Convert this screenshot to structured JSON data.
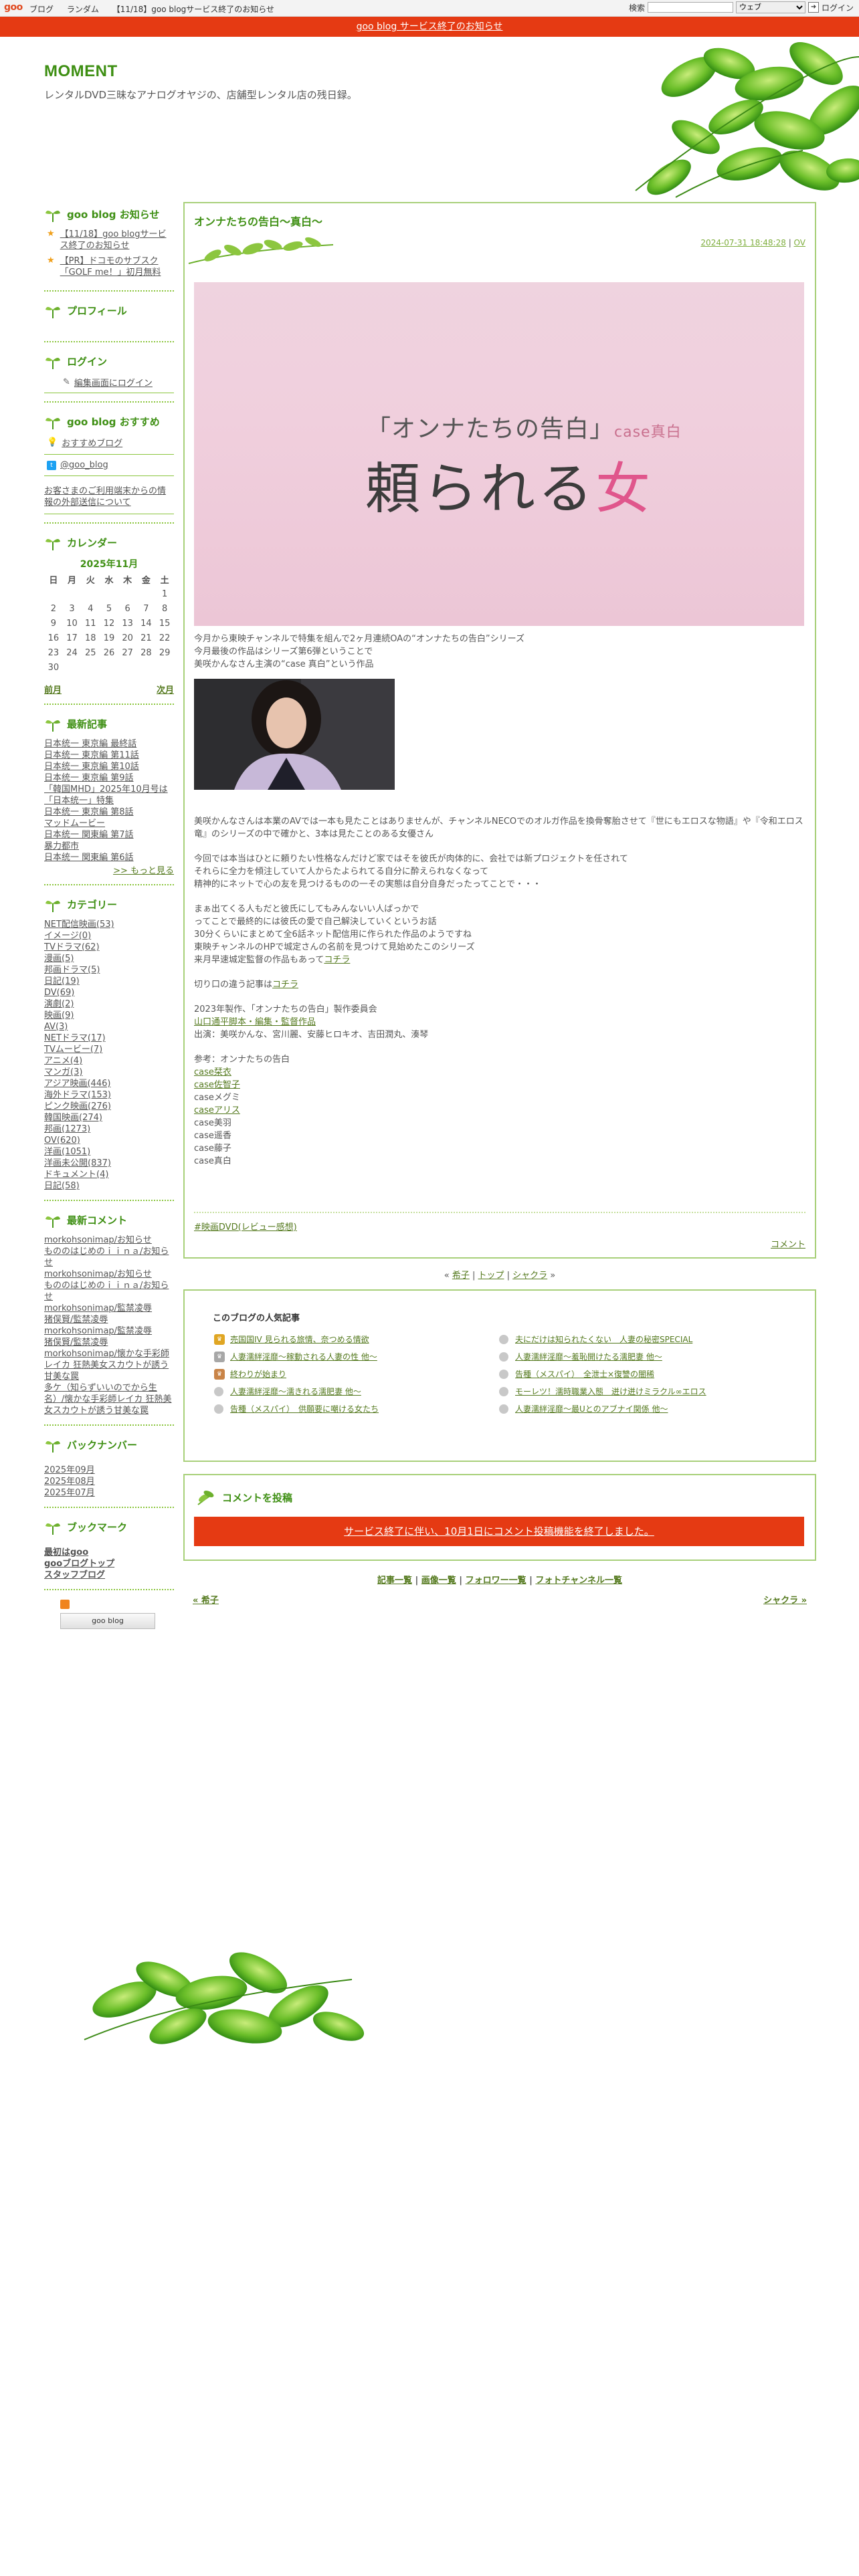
{
  "topbar": {
    "logo": "goo",
    "links": [
      "ブログ",
      "ランダム",
      "【11/18】goo blogサービス終了のお知らせ"
    ],
    "search_label": "検索",
    "search_scope": "ウェブ",
    "login": "ログイン"
  },
  "notice_banner": "goo blog サービス終了のお知らせ",
  "site": {
    "title": "MOMENT",
    "description": "レンタルDVD三昧なアナログオヤジの、店舗型レンタル店の残日録。"
  },
  "sidebar": {
    "notices": {
      "title": "goo blog お知らせ",
      "items": [
        "【11/18】goo blogサービス終了のお知らせ",
        "【PR】ドコモのサブスク「GOLF me！」初月無料"
      ]
    },
    "profile": {
      "title": "プロフィール"
    },
    "login": {
      "title": "ログイン",
      "link": "編集画面にログイン"
    },
    "recommend": {
      "title": "goo blog おすすめ",
      "links": [
        "おすすめブログ",
        "@goo_blog"
      ],
      "info": "お客さまのご利用端末からの情報の外部送信について"
    },
    "calendar": {
      "title": "カレンダー",
      "month": "2025年11月",
      "weekdays": [
        "日",
        "月",
        "火",
        "水",
        "木",
        "金",
        "土"
      ],
      "weeks": [
        [
          "",
          "",
          "",
          "",
          "",
          "",
          "1"
        ],
        [
          "2",
          "3",
          "4",
          "5",
          "6",
          "7",
          "8"
        ],
        [
          "9",
          "10",
          "11",
          "12",
          "13",
          "14",
          "15"
        ],
        [
          "16",
          "17",
          "18",
          "19",
          "20",
          "21",
          "22"
        ],
        [
          "23",
          "24",
          "25",
          "26",
          "27",
          "28",
          "29"
        ],
        [
          "30",
          "",
          "",
          "",
          "",
          "",
          ""
        ]
      ],
      "prev": "前月",
      "next": "次月"
    },
    "recent": {
      "title": "最新記事",
      "items": [
        "日本统一 東京編 最終話",
        "日本统一 東京編 第11話",
        "日本统一 東京編 第10話",
        "日本统一 東京編 第9話",
        "「韓国MHD」2025年10月号は「日本统一」特集",
        "日本统一 東京編 第8話",
        "マッドムービー",
        "日本统一 関東編 第7話",
        "暴力都市",
        "日本统一 関東編 第6話"
      ],
      "more": ">> もっと見る"
    },
    "categories": {
      "title": "カテゴリー",
      "items": [
        "NET配信映画(53)",
        "イメージ(0)",
        "TVドラマ(62)",
        "漫画(5)",
        "邦画ドラマ(5)",
        "日記(19)",
        "DV(69)",
        "演劇(2)",
        "映画(9)",
        "AV(3)",
        "NETドラマ(17)",
        "TVムービー(7)",
        "アニメ(4)",
        "マンガ(3)",
        "アジア映画(446)",
        "海外ドラマ(153)",
        "ピンク映画(276)",
        "韓国映画(274)",
        "邦画(1273)",
        "OV(620)",
        "洋画(1051)",
        "洋画未公開(837)",
        "ドキュメント(4)",
        "日記(58)"
      ]
    },
    "comments": {
      "title": "最新コメント",
      "items": [
        "morkohsonimap/お知らせ",
        "もののはじめのｉｉｎａ/お知らせ",
        "morkohsonimap/お知らせ",
        "もののはじめのｉｉｎａ/お知らせ",
        "morkohsonimap/監禁凌辱",
        "猪俣賢/監禁凌辱",
        "morkohsonimap/監禁凌辱",
        "猪俣賢/監禁凌辱",
        "morkohsonimap/懐かな手彩師レイカ 狂熱美女スカウトが誘う甘美な罠",
        "多ケ（知らずいいのでから生名）/懐かな手彩師レイカ 狂熱美女スカウトが誘う甘美な罠"
      ]
    },
    "backnumber": {
      "title": "バックナンバー",
      "items": [
        "2025年09月",
        "2025年08月",
        "2025年07月"
      ]
    },
    "bookmark": {
      "title": "ブックマーク",
      "items": [
        "最初はgoo",
        "gooブログトップ",
        "スタッフブログ"
      ]
    },
    "badge": "goo blog"
  },
  "entry": {
    "title": "オンナたちの告白〜真白〜",
    "date": "2024-07-31 18:48:28",
    "author": "OV",
    "hero": {
      "subtitle": "「オンナたちの告白」",
      "case_label": "case真白",
      "main_prefix": "頼られる",
      "main_accent": "女"
    },
    "paragraphs": [
      "今月から東映チャンネルで特集を組んで2ヶ月連続OAの“オンナたちの告白”シリーズ",
      "今月最後の作品はシリーズ第6弾ということで",
      "美咲かんなさん主演の“case 真白”という作品"
    ],
    "body2": [
      "美咲かんなさんは本業のAVでは一本も見たことはありませんが、チャンネルNECOでのオルガ作品を換骨奪胎させて『世にもエロスな物語』や『令和エロス竜』のシリーズの中で確かと、3本は見たことのある女優さん",
      "今回では本当はひとに頼りたい性格なんだけど家ではそを彼氏が肉体的に、会社では新プロジェクトを任されて",
      "それらに全力を傾注していて人からたよられてる自分に酔えられなくなって",
      "精神的にネットで心の友を見つけるものの一その実態は自分自身だったってことで・・・",
      "まぁ出てくる人もだと彼氏にしてもみんないい人ばっかで",
      "ってことで最終的には彼氏の愛で自己解決していくというお話",
      "30分くらいにまとめて全6話ネット配信用に作られた作品のようですね",
      "東映チャンネルのHPで城定さんの名前を見つけて見始めたこのシリーズ",
      "来月早速城定監督の作品もあってコチラも楽しみ",
      "切り口の違う記事はコチラ",
      "2023年製作、「オンナたちの告白」製作委員会",
      "山口通平脚本・編集・監督作品",
      "出演：美咲かんな、宮川麗、安藤ヒロキオ、吉田潤丸、湊琴",
      "参考：オンナたちの告白",
      "case栞衣",
      "case佐智子",
      "caseメグミ",
      "caseアリス",
      "case美羽",
      "case遥香",
      "case藤子",
      "case真白"
    ],
    "tag": "#映画DVD(レビュー感想)",
    "comment_link": "コメント"
  },
  "pager": {
    "prev": "希子",
    "top": "トップ",
    "next": "シャクラ"
  },
  "popular": {
    "title": "このブログの人気記事",
    "items": [
      "売国国IV 見られる旅情、奈つめる情欲",
      "夫にだけは知られたくない　人妻の秘密SPECIAL",
      "人妻濡絆淫靡〜稼動される人妻の性 他〜",
      "人妻濡絆淫靡〜羞恥開けたる濡肥妻 他〜",
      "終わりが始まり",
      "告種（メスパイ）　全泄士×復讐の闇稀",
      "人妻濡絆淫靡〜濡きれる濡肥妻 他〜",
      "モーレツ！濡時職業入態　迸け迸けミラクル∞エロス",
      "告種（メスパイ）　供願要に嘲ける女たち",
      "人妻濡絆淫靡〜最Uとのアブナイ関係 他〜"
    ]
  },
  "post_comment": {
    "title": "コメントを投稿",
    "closed": "サービス終了に伴い、10月1日にコメント投稿機能を終了しました。"
  },
  "footer": {
    "links": [
      "記事一覧",
      "画像一覧",
      "フォロワー一覧",
      "フォトチャンネル一覧"
    ],
    "prev": "« 希子",
    "next": "シャクラ »"
  },
  "colors": {
    "accent_green": "#3e8f13",
    "link_green": "#557a1f",
    "border_green": "#a8d07a",
    "notice_red": "#e53a13"
  }
}
